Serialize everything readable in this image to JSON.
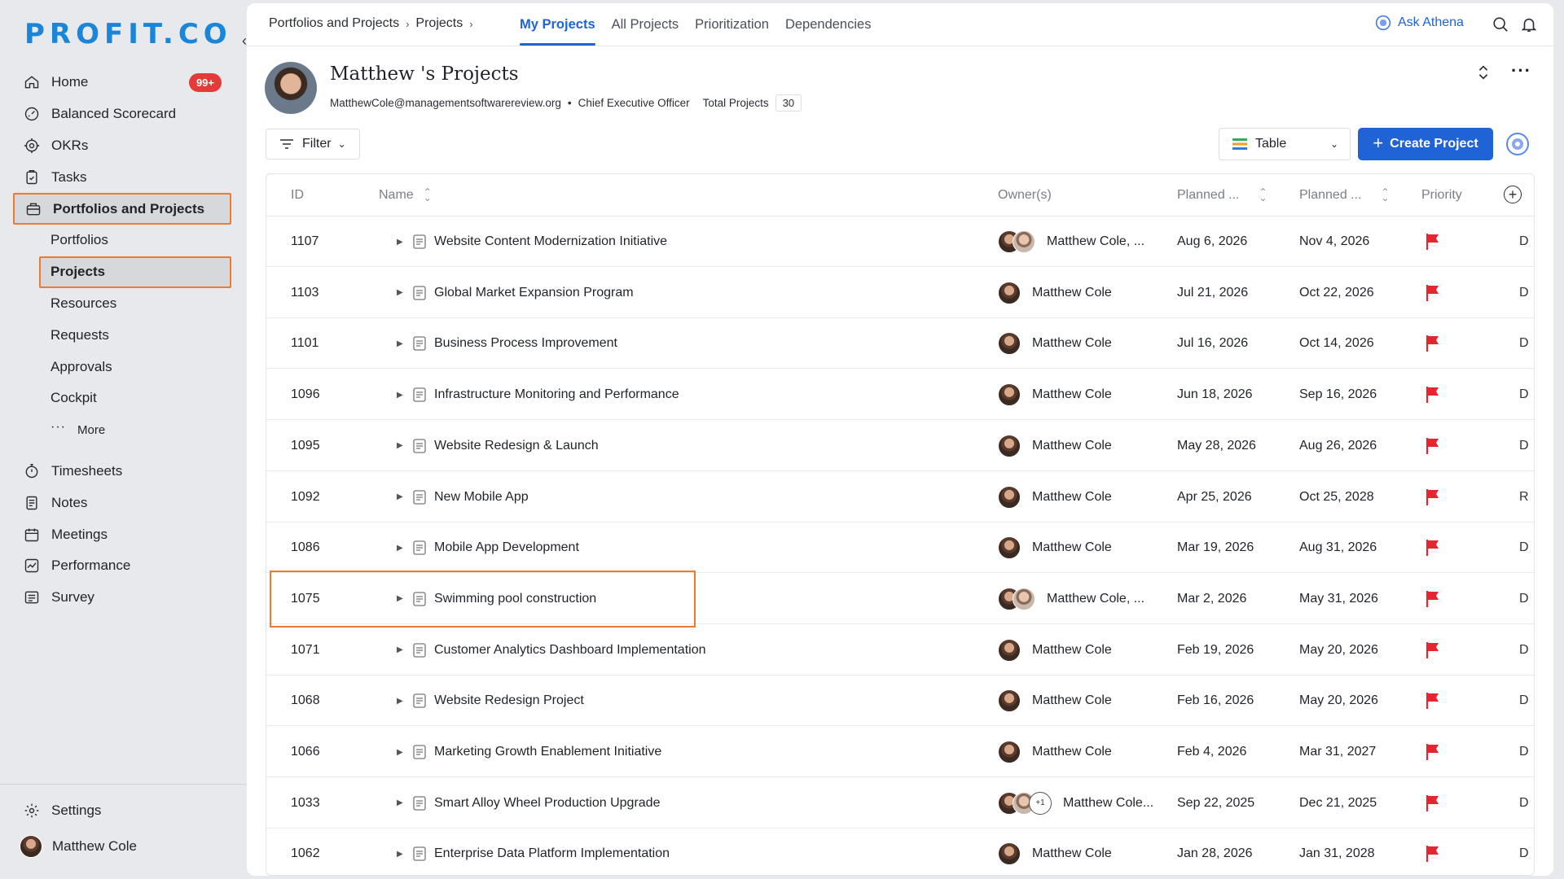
{
  "brand": {
    "logo_text": "PROFIT.CO",
    "color": "#1a86d9"
  },
  "sidebar": {
    "items": [
      {
        "label": "Home",
        "icon": "home-icon",
        "badge": "99+"
      },
      {
        "label": "Balanced Scorecard",
        "icon": "scorecard-icon"
      },
      {
        "label": "OKRs",
        "icon": "target-icon"
      },
      {
        "label": "Tasks",
        "icon": "clipboard-icon"
      },
      {
        "label": "Portfolios and Projects",
        "icon": "briefcase-icon",
        "active": true
      }
    ],
    "sub_items": [
      {
        "label": "Portfolios"
      },
      {
        "label": "Projects",
        "active": true
      },
      {
        "label": "Resources"
      },
      {
        "label": "Requests"
      },
      {
        "label": "Approvals"
      },
      {
        "label": "Cockpit"
      },
      {
        "label": "More"
      }
    ],
    "items_lower": [
      {
        "label": "Timesheets",
        "icon": "stopwatch-icon"
      },
      {
        "label": "Notes",
        "icon": "notes-icon"
      },
      {
        "label": "Meetings",
        "icon": "calendar-icon"
      },
      {
        "label": "Performance",
        "icon": "performance-icon"
      },
      {
        "label": "Survey",
        "icon": "survey-icon"
      }
    ],
    "settings_label": "Settings",
    "user_name": "Matthew Cole"
  },
  "topbar": {
    "breadcrumb": [
      "Portfolios and Projects",
      "Projects"
    ],
    "tabs": [
      "My Projects",
      "All Projects",
      "Prioritization",
      "Dependencies"
    ],
    "active_tab": "My Projects",
    "ask_label": "Ask Athena"
  },
  "profile": {
    "title": "Matthew 's Projects",
    "email": "MatthewCole@managementsoftwarereview.org",
    "role": "Chief Executive Officer",
    "total_label": "Total Projects",
    "total_count": "30"
  },
  "toolbar": {
    "filter_label": "Filter",
    "view_label": "Table",
    "create_label": "Create Project",
    "accent": "#1f63d6"
  },
  "table": {
    "headers": {
      "id": "ID",
      "name": "Name",
      "owner": "Owner(s)",
      "planned_start": "Planned ...",
      "planned_end": "Planned ...",
      "priority": "Priority"
    },
    "priority_color": "#e3262f",
    "rows": [
      {
        "id": "1107",
        "name": "Website Content Modernization Initiative",
        "owner": "Matthew Cole, ...",
        "avatars": 2,
        "start": "Aug 6, 2026",
        "end": "Nov 4, 2026",
        "extra": "D"
      },
      {
        "id": "1103",
        "name": "Global Market Expansion Program",
        "owner": "Matthew Cole",
        "avatars": 1,
        "start": "Jul 21, 2026",
        "end": "Oct 22, 2026",
        "extra": "D"
      },
      {
        "id": "1101",
        "name": "Business Process Improvement",
        "owner": "Matthew Cole",
        "avatars": 1,
        "start": "Jul 16, 2026",
        "end": "Oct 14, 2026",
        "extra": "D"
      },
      {
        "id": "1096",
        "name": "Infrastructure Monitoring and Performance",
        "owner": "Matthew Cole",
        "avatars": 1,
        "start": "Jun 18, 2026",
        "end": "Sep 16, 2026",
        "extra": "D"
      },
      {
        "id": "1095",
        "name": "Website Redesign & Launch",
        "owner": "Matthew Cole",
        "avatars": 1,
        "start": "May 28, 2026",
        "end": "Aug 26, 2026",
        "extra": "D"
      },
      {
        "id": "1092",
        "name": "New Mobile App",
        "owner": "Matthew Cole",
        "avatars": 1,
        "start": "Apr 25, 2026",
        "end": "Oct 25, 2028",
        "extra": "R"
      },
      {
        "id": "1086",
        "name": "Mobile App Development",
        "owner": "Matthew Cole",
        "avatars": 1,
        "start": "Mar 19, 2026",
        "end": "Aug 31, 2026",
        "extra": "D"
      },
      {
        "id": "1075",
        "name": "Swimming pool construction",
        "owner": "Matthew Cole, ...",
        "avatars": 2,
        "start": "Mar 2, 2026",
        "end": "May 31, 2026",
        "extra": "D",
        "highlighted": true
      },
      {
        "id": "1071",
        "name": "Customer Analytics Dashboard Implementation",
        "owner": "Matthew Cole",
        "avatars": 1,
        "start": "Feb 19, 2026",
        "end": "May 20, 2026",
        "extra": "D"
      },
      {
        "id": "1068",
        "name": "Website Redesign Project",
        "owner": "Matthew Cole",
        "avatars": 1,
        "start": "Feb 16, 2026",
        "end": "May 20, 2026",
        "extra": "D"
      },
      {
        "id": "1066",
        "name": "Marketing Growth Enablement Initiative",
        "owner": "Matthew Cole",
        "avatars": 1,
        "start": "Feb 4, 2026",
        "end": "Mar 31, 2027",
        "extra": "D"
      },
      {
        "id": "1033",
        "name": "Smart Alloy Wheel Production Upgrade",
        "owner": "Matthew Cole...",
        "avatars": 2,
        "more": "+1",
        "start": "Sep 22, 2025",
        "end": "Dec 21, 2025",
        "extra": "D"
      },
      {
        "id": "1062",
        "name": "Enterprise Data Platform Implementation",
        "owner": "Matthew Cole",
        "avatars": 1,
        "start": "Jan 28, 2026",
        "end": "Jan 31, 2028",
        "extra": "D"
      }
    ]
  }
}
